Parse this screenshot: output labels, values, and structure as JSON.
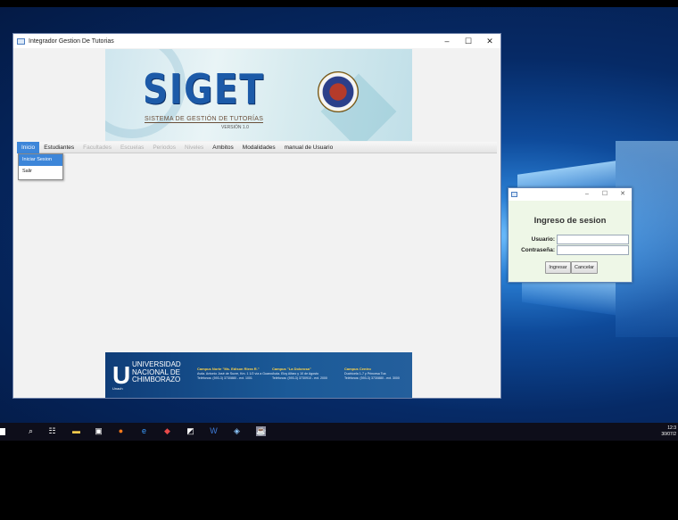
{
  "main_window": {
    "title": "Integrador Gestion De Tutorias",
    "controls": {
      "minimize": "–",
      "maximize": "☐",
      "close": "✕"
    }
  },
  "banner": {
    "logo_text": "SIGET",
    "subtitle": "SISTEMA DE GESTIÓN DE TUTORÍAS",
    "version": "VERSIÓN 1.0"
  },
  "menu": {
    "items": [
      {
        "label": "Inicio",
        "state": "active"
      },
      {
        "label": "Estudiantes",
        "state": "enabled"
      },
      {
        "label": "Facultades",
        "state": "disabled"
      },
      {
        "label": "Escuelas",
        "state": "disabled"
      },
      {
        "label": "Periodos",
        "state": "disabled"
      },
      {
        "label": "Niveles",
        "state": "disabled"
      },
      {
        "label": "Ambitos",
        "state": "enabled"
      },
      {
        "label": "Modalidades",
        "state": "enabled"
      },
      {
        "label": "manual de Usuario",
        "state": "enabled"
      }
    ],
    "dropdown": [
      {
        "label": "Iniciar Sesion",
        "selected": true
      },
      {
        "label": "Salir",
        "selected": false
      }
    ]
  },
  "footer_banner": {
    "logo_letter": "U",
    "logo_small": "Unach",
    "university_name_1": "UNIVERSIDAD",
    "university_name_2": "NACIONAL DE",
    "university_name_3": "CHIMBORAZO",
    "campus": [
      {
        "name": "Campus Norte \"Ms. Edison Riera R.\"",
        "line1": "Avda. Antonio José de Sucre, Km. 1 1/2 vía a Guano",
        "line2": "Teléfonos: (593-3) 3730880 - ext. 1001"
      },
      {
        "name": "Campus \"La Dolorosa\"",
        "line1": "Avda. Eloy Alfaro y 10 de Agosto",
        "line2": "Teléfonos: (593-3) 3730910 - ext. 2000"
      },
      {
        "name": "Campus Centro",
        "line1": "Duchicela 1-7 y Princesa Toa",
        "line2": "Teléfonos: (593-3) 3730880 - ext. 3000"
      }
    ]
  },
  "login_window": {
    "title": "Ingreso de sesion",
    "user_label": "Usuario:",
    "password_label": "Contraseña:",
    "user_value": "",
    "password_value": "",
    "login_button": "Ingresar",
    "cancel_button": "Cancelar",
    "controls": {
      "minimize": "–",
      "maximize": "☐",
      "close": "✕"
    }
  },
  "taskbar": {
    "time": "12:3",
    "date": "30/07/2"
  },
  "colors": {
    "menu_active": "#3d86d9",
    "login_bg": "#eef7e7",
    "footer_banner": "#1b5a98"
  }
}
